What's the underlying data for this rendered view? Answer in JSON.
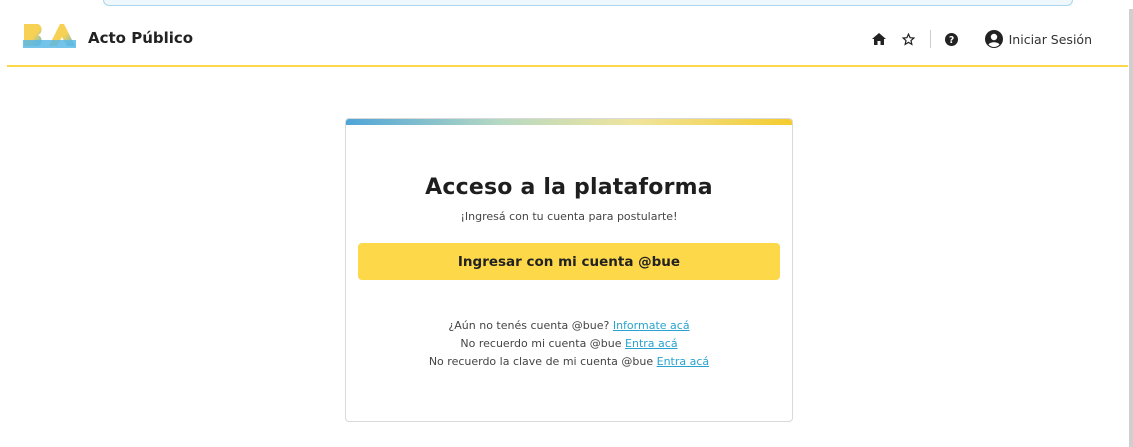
{
  "header": {
    "brand": "Acto Público",
    "logo_colors": [
      "#f7d154",
      "#5bb8e6"
    ],
    "icons": [
      "home-icon",
      "star-icon",
      "question-icon",
      "user-circle-icon"
    ],
    "login_label": "Iniciar Sesión"
  },
  "card": {
    "title": "Acceso a la plataforma",
    "subtitle": "¡Ingresá con tu cuenta para postularte!",
    "button_label": "Ingresar con mi cuenta @bue",
    "links": [
      {
        "text": "¿Aún no tenés cuenta @bue?",
        "link": "Informate acá"
      },
      {
        "text": "No recuerdo mi cuenta @bue",
        "link": "Entra acá"
      },
      {
        "text": "No recuerdo la clave de mi cuenta @bue",
        "link": "Entra acá"
      }
    ]
  },
  "colors": {
    "accent_yellow": "#fdd848",
    "link_blue": "#2aa2cf"
  }
}
